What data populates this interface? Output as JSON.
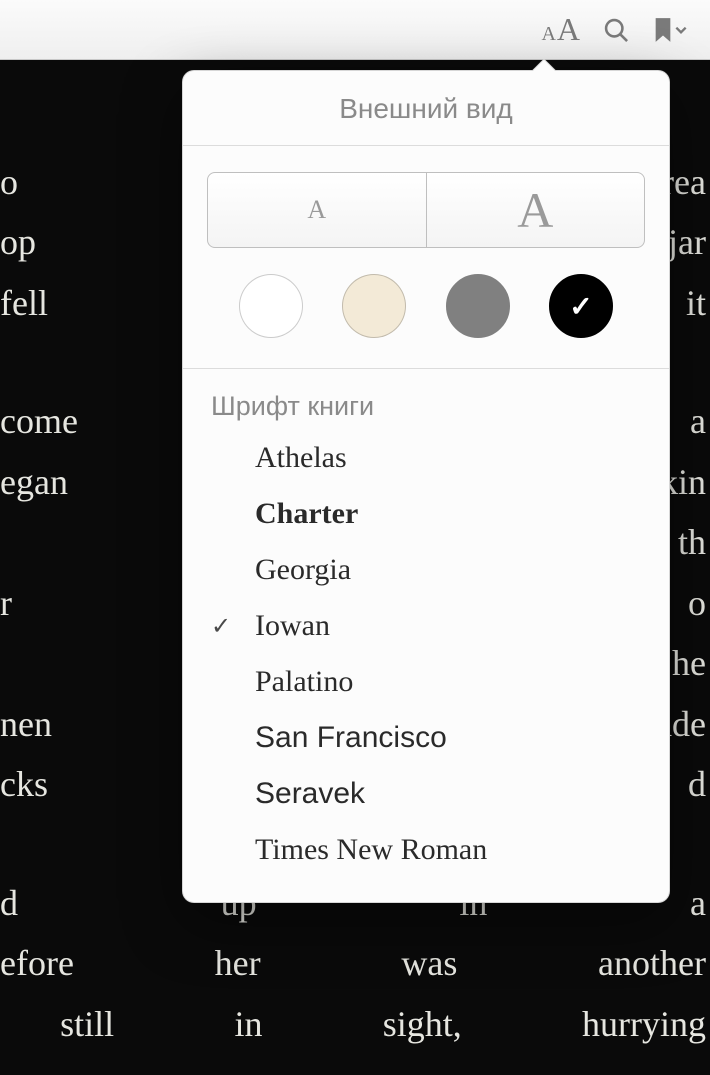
{
  "toolbar": {
    "icons": {
      "font_size": "aA",
      "search": "search-icon",
      "bookmark": "bookmark-icon",
      "chevron": "chevron-down-icon"
    }
  },
  "book_text": {
    "p1": "o her grea\nop the jar\nfell past it",
    "p2": "come to a\negan  talkin\n should  th\nr  saucer  o\n  down   he\nnen   sudde\ncks and d",
    "p3": "d up in a\nefore  her  was  another\n still  in  sight,  hurrying"
  },
  "popover": {
    "title": "Внешний вид",
    "size_small_label": "A",
    "size_large_label": "A",
    "themes": [
      {
        "key": "white",
        "selected": false
      },
      {
        "key": "sepia",
        "selected": false
      },
      {
        "key": "gray",
        "selected": false
      },
      {
        "key": "black",
        "selected": true
      }
    ],
    "font_section_label": "Шрифт книги",
    "fonts": [
      {
        "name": "Athelas",
        "css": "font-athelas",
        "selected": false
      },
      {
        "name": "Charter",
        "css": "font-charter",
        "selected": false
      },
      {
        "name": "Georgia",
        "css": "font-georgia",
        "selected": false
      },
      {
        "name": "Iowan",
        "css": "font-iowan",
        "selected": true
      },
      {
        "name": "Palatino",
        "css": "font-palatino",
        "selected": false
      },
      {
        "name": "San Francisco",
        "css": "font-sanfrancisco",
        "selected": false
      },
      {
        "name": "Seravek",
        "css": "font-seravek",
        "selected": false
      },
      {
        "name": "Times New Roman",
        "css": "font-times",
        "selected": false
      }
    ],
    "checkmark": "✓"
  },
  "colors": {
    "toolbar_bg_top": "#fbfbfb",
    "toolbar_bg_bottom": "#efefef",
    "book_bg": "#0a0a0a",
    "book_fg": "#e6e6e0",
    "popover_bg": "#fcfcfc"
  }
}
